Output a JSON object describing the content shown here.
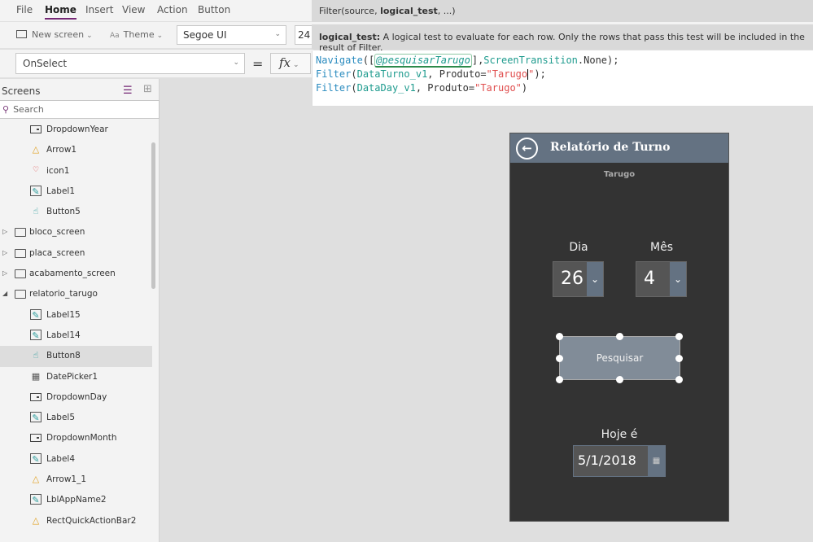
{
  "menu": {
    "items": [
      {
        "label": "File",
        "active": false
      },
      {
        "label": "Home",
        "active": true
      },
      {
        "label": "Insert",
        "active": false
      },
      {
        "label": "View",
        "active": false
      },
      {
        "label": "Action",
        "active": false
      },
      {
        "label": "Button",
        "active": false
      }
    ]
  },
  "ribbon": {
    "new_screen_label": "New screen",
    "theme_label": "Theme",
    "font_value": "Segoe UI",
    "font_size_value": "24"
  },
  "formula_bar": {
    "property_value": "OnSelect",
    "equals": "=",
    "fx_label": "fx"
  },
  "intellisense": {
    "signature_prefix": "Filter(source, ",
    "signature_bold": "logical_test",
    "signature_suffix": ", ...)",
    "param_name": "logical_test:",
    "param_description": " A logical test to evaluate for each row. Only the rows that pass this test will be included in the result of Filter."
  },
  "code": {
    "line1": {
      "fn": "Navigate",
      "open": "([",
      "ctl": "@pesquisarTarugo",
      "mid": "],",
      "id": "ScreenTransition",
      "rest": ".None);"
    },
    "line2": {
      "fn": "Filter",
      "open": "(",
      "id": "DataTurno_v1",
      "mid": ", Produto=",
      "str_a": "\"Tarugo",
      "str_b": "\"",
      "end": ");"
    },
    "line3": {
      "fn": "Filter",
      "open": "(",
      "id": "DataDay_v1",
      "mid": ", Produto=",
      "str": "\"Tarugo\"",
      "end": ")"
    }
  },
  "left_panel": {
    "title": "Screens",
    "search_placeholder": "Search",
    "tree": [
      {
        "label": "DropdownYear",
        "icon": "dropdown-icon",
        "level": 1
      },
      {
        "label": "Arrow1",
        "icon": "shapes-icon",
        "level": 1
      },
      {
        "label": "icon1",
        "icon": "icons-icon",
        "level": 1
      },
      {
        "label": "Label1",
        "icon": "label-icon",
        "level": 1
      },
      {
        "label": "Button5",
        "icon": "button-icon",
        "level": 1
      },
      {
        "label": "bloco_screen",
        "icon": "screen-icon",
        "level": 0,
        "expanded": false
      },
      {
        "label": "placa_screen",
        "icon": "screen-icon",
        "level": 0,
        "expanded": false
      },
      {
        "label": "acabamento_screen",
        "icon": "screen-icon",
        "level": 0,
        "expanded": false
      },
      {
        "label": "relatorio_tarugo",
        "icon": "screen-icon",
        "level": 0,
        "expanded": true
      },
      {
        "label": "Label15",
        "icon": "label-icon",
        "level": 1
      },
      {
        "label": "Label14",
        "icon": "label-icon",
        "level": 1
      },
      {
        "label": "Button8",
        "icon": "button-icon",
        "level": 1,
        "selected": true
      },
      {
        "label": "DatePicker1",
        "icon": "datepicker-icon",
        "level": 1
      },
      {
        "label": "DropdownDay",
        "icon": "dropdown-icon",
        "level": 1
      },
      {
        "label": "Label5",
        "icon": "label-icon",
        "level": 1
      },
      {
        "label": "DropdownMonth",
        "icon": "dropdown-icon",
        "level": 1
      },
      {
        "label": "Label4",
        "icon": "label-icon",
        "level": 1
      },
      {
        "label": "Arrow1_1",
        "icon": "shapes-icon",
        "level": 1
      },
      {
        "label": "LblAppName2",
        "icon": "label-icon",
        "level": 1
      },
      {
        "label": "RectQuickActionBar2",
        "icon": "shapes-icon",
        "level": 1
      }
    ]
  },
  "app": {
    "title": "Relatório de Turno",
    "subtitle": "Tarugo",
    "day_label": "Dia",
    "day_value": "26",
    "month_label": "Mês",
    "month_value": "4",
    "search_button": "Pesquisar",
    "today_label": "Hoje é",
    "today_value": "5/1/2018"
  },
  "colors": {
    "accent": "#742774",
    "app_header": "#647282",
    "app_background": "#333333",
    "button": "#818c98"
  }
}
